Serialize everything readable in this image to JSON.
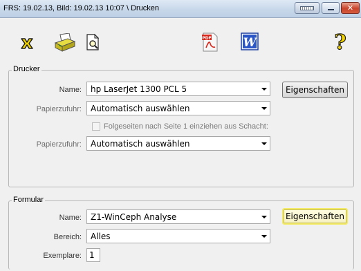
{
  "window": {
    "title": "FRS: 19.02.13,  Bild: 19.02.13 10:07 \\ Drucken",
    "close_symbol": "✕"
  },
  "toolbar": {
    "icons": [
      "cancel-icon",
      "printer-icon",
      "print-preview-icon",
      "pdf-icon",
      "word-icon",
      "help-icon"
    ],
    "pdf_badge": "PDF",
    "word_letter": "W",
    "help_symbol": "?"
  },
  "printer_group": {
    "title": "Drucker",
    "name_label": "Name:",
    "name_value": "hp LaserJet 1300 PCL 5",
    "properties_button": "Eigenschaften",
    "paper_feed1_label": "Papierzufuhr:",
    "paper_feed1_value": "Automatisch auswählen",
    "following_pages_label": "Folgeseiten nach Seite 1 einziehen aus Schacht:",
    "following_pages_checked": false,
    "paper_feed2_label": "Papierzufuhr:",
    "paper_feed2_value": "Automatisch auswählen"
  },
  "form_group": {
    "title": "Formular",
    "name_label": "Name:",
    "name_value": "Z1-WinCeph Analyse",
    "properties_button": "Eigenschaften",
    "range_label": "Bereich:",
    "range_value": "Alles",
    "copies_label": "Exemplare:",
    "copies_value": "1"
  },
  "colors": {
    "window_bg": "#f0f0f0",
    "titlebar": "#c8d8ea",
    "focus_button": "#f5eb6a",
    "close_button": "#c9442d"
  }
}
